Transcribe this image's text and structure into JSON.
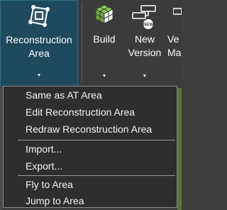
{
  "ribbon": {
    "reconstruction": {
      "label_line1": "Reconstruction",
      "label_line2": "Area",
      "icon": "reconstruction-area-icon"
    },
    "build": {
      "label": "Build",
      "icon": "build-cube-icon"
    },
    "new_version": {
      "label_line1": "New",
      "label_line2": "Version",
      "icon": "new-version-icon"
    },
    "partial": {
      "label_line1": "Ve",
      "label_line2": "Ma"
    }
  },
  "menu": {
    "items": [
      "Same as AT Area",
      "Edit Reconstruction Area",
      "Redraw Reconstruction Area",
      "Import...",
      "Export...",
      "Fly to Area",
      "Jump to Area"
    ]
  },
  "colors": {
    "accent": "#1f4a5e",
    "accent_border": "#2c6a86",
    "menu_bg": "#2e2e2e",
    "green_icon": "#7cc142"
  }
}
